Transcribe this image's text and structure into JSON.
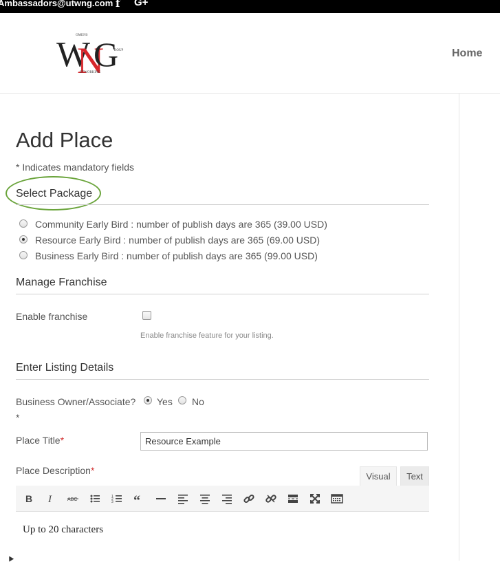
{
  "topbar": {
    "email": "Ambassadors@utwng.com",
    "facebook_glyph": "f",
    "gplus_glyph": "G+"
  },
  "header": {
    "logo_text": "WNG",
    "nav_home": "Home"
  },
  "page": {
    "title": "Add Place",
    "mandatory_note": "* Indicates mandatory fields"
  },
  "package": {
    "title": "Select Package",
    "options": [
      {
        "label": "Community Early Bird : number of publish days are 365 (39.00 USD)",
        "checked": false
      },
      {
        "label": "Resource Early Bird : number of publish days are 365 (69.00 USD)",
        "checked": true
      },
      {
        "label": "Business Early Bird : number of publish days are 365 (99.00 USD)",
        "checked": false
      }
    ]
  },
  "franchise": {
    "title": "Manage Franchise",
    "enable_label": "Enable franchise",
    "help": "Enable franchise feature for your listing."
  },
  "listing": {
    "title": "Enter Listing Details",
    "owner_label": "Business Owner/Associate?",
    "owner_yes": "Yes",
    "owner_no": "No",
    "required_mark": "*",
    "place_title_label": "Place Title",
    "place_title_value": "Resource Example",
    "place_desc_label": "Place Description",
    "tab_visual": "Visual",
    "tab_text": "Text",
    "editor_content": "Up to 20 characters"
  },
  "toolbar_icons": [
    "bold-icon",
    "italic-icon",
    "strikethrough-icon",
    "bullet-list-icon",
    "numbered-list-icon",
    "blockquote-icon",
    "horizontal-line-icon",
    "align-left-icon",
    "align-center-icon",
    "align-right-icon",
    "link-icon",
    "unlink-icon",
    "read-more-icon",
    "fullscreen-icon",
    "toolbar-toggle-icon"
  ],
  "colors": {
    "accent_circle": "#6aa43b",
    "required": "#d12e2e",
    "logo_red": "#d6262b"
  }
}
